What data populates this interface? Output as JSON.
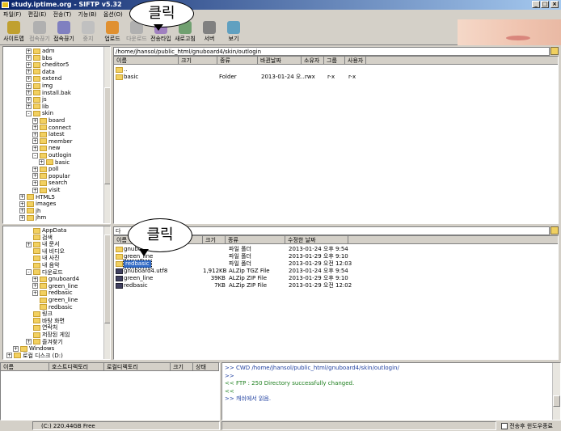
{
  "title": "study.iptime.org - SIFTP v5.32",
  "menu": [
    "파일(F)",
    "편집(E)",
    "전송(T)",
    "기능(B)",
    "옵션(O)",
    "도"
  ],
  "toolbar": [
    {
      "label": "사이트맵",
      "icon": "sitemap-icon",
      "color": "#c0a030",
      "enabled": true
    },
    {
      "label": "접속끊기",
      "icon": "disconnect-icon",
      "color": "#b0b0b0",
      "enabled": false
    },
    {
      "label": "접속끊기",
      "icon": "connect-icon",
      "color": "#8080c0",
      "enabled": true
    },
    {
      "label": "중지",
      "icon": "stop-icon",
      "color": "#c0c0c0",
      "enabled": false
    },
    {
      "label": "업로드",
      "icon": "upload-icon",
      "color": "#e09030",
      "enabled": true
    },
    {
      "label": "다운로드",
      "icon": "download-icon",
      "color": "#b0b0b0",
      "enabled": false
    },
    {
      "label": "전송타입",
      "icon": "transfer-type-icon",
      "color": "#a080c0",
      "enabled": true
    },
    {
      "label": "새로고침",
      "icon": "refresh-icon",
      "color": "#70a070",
      "enabled": true
    },
    {
      "label": "서버",
      "icon": "server-icon",
      "color": "#808080",
      "enabled": true
    },
    {
      "label": "보기",
      "icon": "view-icon",
      "color": "#60a0c0",
      "enabled": true
    }
  ],
  "callout_text": "클릭",
  "remote_tree": [
    {
      "label": "adm",
      "indent": 5,
      "pm": "+"
    },
    {
      "label": "bbs",
      "indent": 5,
      "pm": "+"
    },
    {
      "label": "cheditor5",
      "indent": 5,
      "pm": "+"
    },
    {
      "label": "data",
      "indent": 5,
      "pm": "+"
    },
    {
      "label": "extend",
      "indent": 5,
      "pm": "+"
    },
    {
      "label": "img",
      "indent": 5,
      "pm": "+"
    },
    {
      "label": "install.bak",
      "indent": 5,
      "pm": "+"
    },
    {
      "label": "js",
      "indent": 5,
      "pm": "+"
    },
    {
      "label": "lib",
      "indent": 5,
      "pm": "+"
    },
    {
      "label": "skin",
      "indent": 5,
      "pm": "-"
    },
    {
      "label": "board",
      "indent": 6,
      "pm": "+"
    },
    {
      "label": "connect",
      "indent": 6,
      "pm": "+"
    },
    {
      "label": "latest",
      "indent": 6,
      "pm": "+"
    },
    {
      "label": "member",
      "indent": 6,
      "pm": "+"
    },
    {
      "label": "new",
      "indent": 6,
      "pm": "+"
    },
    {
      "label": "outlogin",
      "indent": 6,
      "pm": "-"
    },
    {
      "label": "basic",
      "indent": 7,
      "pm": "+"
    },
    {
      "label": "poll",
      "indent": 6,
      "pm": "+"
    },
    {
      "label": "popular",
      "indent": 6,
      "pm": "+"
    },
    {
      "label": "search",
      "indent": 6,
      "pm": "+"
    },
    {
      "label": "visit",
      "indent": 6,
      "pm": "+"
    },
    {
      "label": "HTML5",
      "indent": 4,
      "pm": "+"
    },
    {
      "label": "images",
      "indent": 4,
      "pm": "+"
    },
    {
      "label": "jh",
      "indent": 4,
      "pm": "+"
    },
    {
      "label": "jhm",
      "indent": 4,
      "pm": "+"
    }
  ],
  "remote_path": "/home/jhansol/public_html/gnuboard4/skin/outlogin",
  "remote_headers": [
    "이름",
    "크기",
    "종류",
    "바뀐날짜",
    "소유자",
    "그룹",
    "사용자"
  ],
  "remote_files": [
    {
      "name": "..",
      "size": "",
      "type": "",
      "date": "",
      "owner": "",
      "group": "",
      "user": ""
    },
    {
      "name": "basic",
      "size": "",
      "type": "Folder",
      "date": "2013-01-24 오...",
      "owner": "rwx",
      "group": "r-x",
      "user": "r-x"
    }
  ],
  "local_tree": [
    {
      "label": "AppData",
      "indent": 5,
      "pm": ""
    },
    {
      "label": "검색",
      "indent": 5,
      "pm": ""
    },
    {
      "label": "내 문서",
      "indent": 5,
      "pm": "+"
    },
    {
      "label": "내 비디오",
      "indent": 5,
      "pm": ""
    },
    {
      "label": "내 사진",
      "indent": 5,
      "pm": ""
    },
    {
      "label": "내 음악",
      "indent": 5,
      "pm": ""
    },
    {
      "label": "다운로드",
      "indent": 5,
      "pm": "-"
    },
    {
      "label": "gnuboard4",
      "indent": 6,
      "pm": "+"
    },
    {
      "label": "green_line",
      "indent": 6,
      "pm": "+"
    },
    {
      "label": "redbasic",
      "indent": 6,
      "pm": "+"
    },
    {
      "label": "green_line",
      "indent": 6,
      "pm": ""
    },
    {
      "label": "redbasic",
      "indent": 6,
      "pm": ""
    },
    {
      "label": "링크",
      "indent": 5,
      "pm": ""
    },
    {
      "label": "바탕 화면",
      "indent": 5,
      "pm": ""
    },
    {
      "label": "연락처",
      "indent": 5,
      "pm": ""
    },
    {
      "label": "저장된 게임",
      "indent": 5,
      "pm": ""
    },
    {
      "label": "즐겨찾기",
      "indent": 5,
      "pm": "+"
    },
    {
      "label": "Windows",
      "indent": 3,
      "pm": "+"
    },
    {
      "label": "로컬 디스크 (D:)",
      "indent": 2,
      "pm": "+"
    }
  ],
  "local_path": "다",
  "local_headers": [
    "이름",
    "크기",
    "종류",
    "수정한 날짜"
  ],
  "local_files": [
    {
      "name": "gnuboard4",
      "size": "",
      "type": "파일 폴더",
      "date": "2013-01-24 오후 9:54",
      "kind": "folder"
    },
    {
      "name": "green_line",
      "size": "",
      "type": "파일 폴더",
      "date": "2013-01-29 오후 9:10",
      "kind": "folder"
    },
    {
      "name": "redbasic",
      "size": "",
      "type": "파일 폴더",
      "date": "2013-01-29 오전 12:03",
      "kind": "folder",
      "selected": true
    },
    {
      "name": "gnuboard4.utf8",
      "size": "1,912KB",
      "type": "ALZip TGZ File",
      "date": "2013-01-24 오후 9:54",
      "kind": "zip"
    },
    {
      "name": "green_line",
      "size": "39KB",
      "type": "ALZip ZIP File",
      "date": "2013-01-29 오후 9:10",
      "kind": "zip"
    },
    {
      "name": "redbasic",
      "size": "7KB",
      "type": "ALZip ZIP File",
      "date": "2013-01-29 오전 12:02",
      "kind": "zip"
    }
  ],
  "queue_headers": [
    "이름",
    "호스트디렉토리",
    "로컬디렉토리",
    "크기",
    "상태"
  ],
  "log": [
    {
      "text": ">> CWD /home/jhansol/public_html/gnuboard4/skin/outlogin/",
      "color": "#2040a0"
    },
    {
      "text": ">>",
      "color": "#2040a0"
    },
    {
      "text": "<< FTP : 250 Directory successfully changed.",
      "color": "#208020"
    },
    {
      "text": "<<",
      "color": "#208020"
    },
    {
      "text": ">> 캐쉬에서 읽음.",
      "color": "#2040a0"
    }
  ],
  "status_drive": "(C:)  220.44GB Free",
  "status_checkbox": "전송후 윈도우종료"
}
